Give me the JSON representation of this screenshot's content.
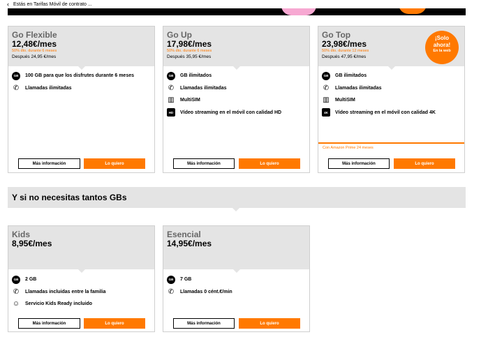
{
  "nav": {
    "back_icon": "chevron-left-icon",
    "breadcrumb": "Estás en Tarifas Móvil de contrato ..."
  },
  "colors": {
    "accent": "#ff7900",
    "card_header": "#e4e4e4"
  },
  "plans": [
    {
      "name": "Go Flexible",
      "price": "12,48€/mes",
      "promo": "50% dto. durante 6 meses",
      "after": "Después 24,95 €/mes",
      "features": [
        {
          "icon": "gb-icon",
          "glyph": "GB",
          "text": "100 GB para que los disfrutes durante 6 meses"
        },
        {
          "icon": "phone-icon",
          "glyph": "✆",
          "text": "Llamadas ilimitadas"
        }
      ],
      "more": "Más información",
      "cta": "Lo quiero"
    },
    {
      "name": "Go Up",
      "price": "17,98€/mes",
      "promo": "50% dto. durante 6 meses",
      "after": "Después 35,95 €/mes",
      "features": [
        {
          "icon": "gb-icon",
          "glyph": "GB",
          "text": "GB ilimitados"
        },
        {
          "icon": "phone-icon",
          "glyph": "✆",
          "text": "Llamadas ilimitadas"
        },
        {
          "icon": "sim-icon",
          "glyph": "▥",
          "text": "MultiSIM"
        },
        {
          "icon": "hd-icon",
          "glyph": "HD",
          "text": "Vídeo streaming en el móvil con calidad HD"
        }
      ],
      "more": "Más información",
      "cta": "Lo quiero"
    },
    {
      "name": "Go Top",
      "price": "23,98€/mes",
      "promo": "50% dto. durante 12 meses",
      "after": "Después 47,95 €/mes",
      "badge": {
        "line1": "¡Solo",
        "line2": "ahora!",
        "line3": "En la web"
      },
      "features": [
        {
          "icon": "gb-icon",
          "glyph": "GB",
          "text": "GB ilimitados"
        },
        {
          "icon": "phone-icon",
          "glyph": "✆",
          "text": "Llamadas ilimitadas"
        },
        {
          "icon": "sim-icon",
          "glyph": "▥",
          "text": "MultiSIM"
        },
        {
          "icon": "4k-icon",
          "glyph": "4K",
          "text": "Vídeo streaming en el móvil con calidad 4K"
        }
      ],
      "extra": "Con Amazon Prime 24 meses",
      "more": "Más información",
      "cta": "Lo quiero"
    }
  ],
  "section_title": "Y si no necesitas tantos GBs",
  "small_plans": [
    {
      "name": "Kids",
      "price": "8,95€/mes",
      "features": [
        {
          "icon": "gb-icon",
          "glyph": "GB",
          "text": "2 GB"
        },
        {
          "icon": "phone-icon",
          "glyph": "✆",
          "text": "Llamadas incluidas entre la familia"
        },
        {
          "icon": "kids-ready-icon",
          "glyph": "☺",
          "text": "Servicio Kids Ready incluido"
        }
      ],
      "more": "Más información",
      "cta": "Lo quiero"
    },
    {
      "name": "Esencial",
      "price": "14,95€/mes",
      "features": [
        {
          "icon": "gb-icon",
          "glyph": "GB",
          "text": "7 GB"
        },
        {
          "icon": "phone-icon",
          "glyph": "✆",
          "text": "Llamadas 0 cént.€/min"
        }
      ],
      "more": "Más información",
      "cta": "Lo quiero"
    }
  ]
}
